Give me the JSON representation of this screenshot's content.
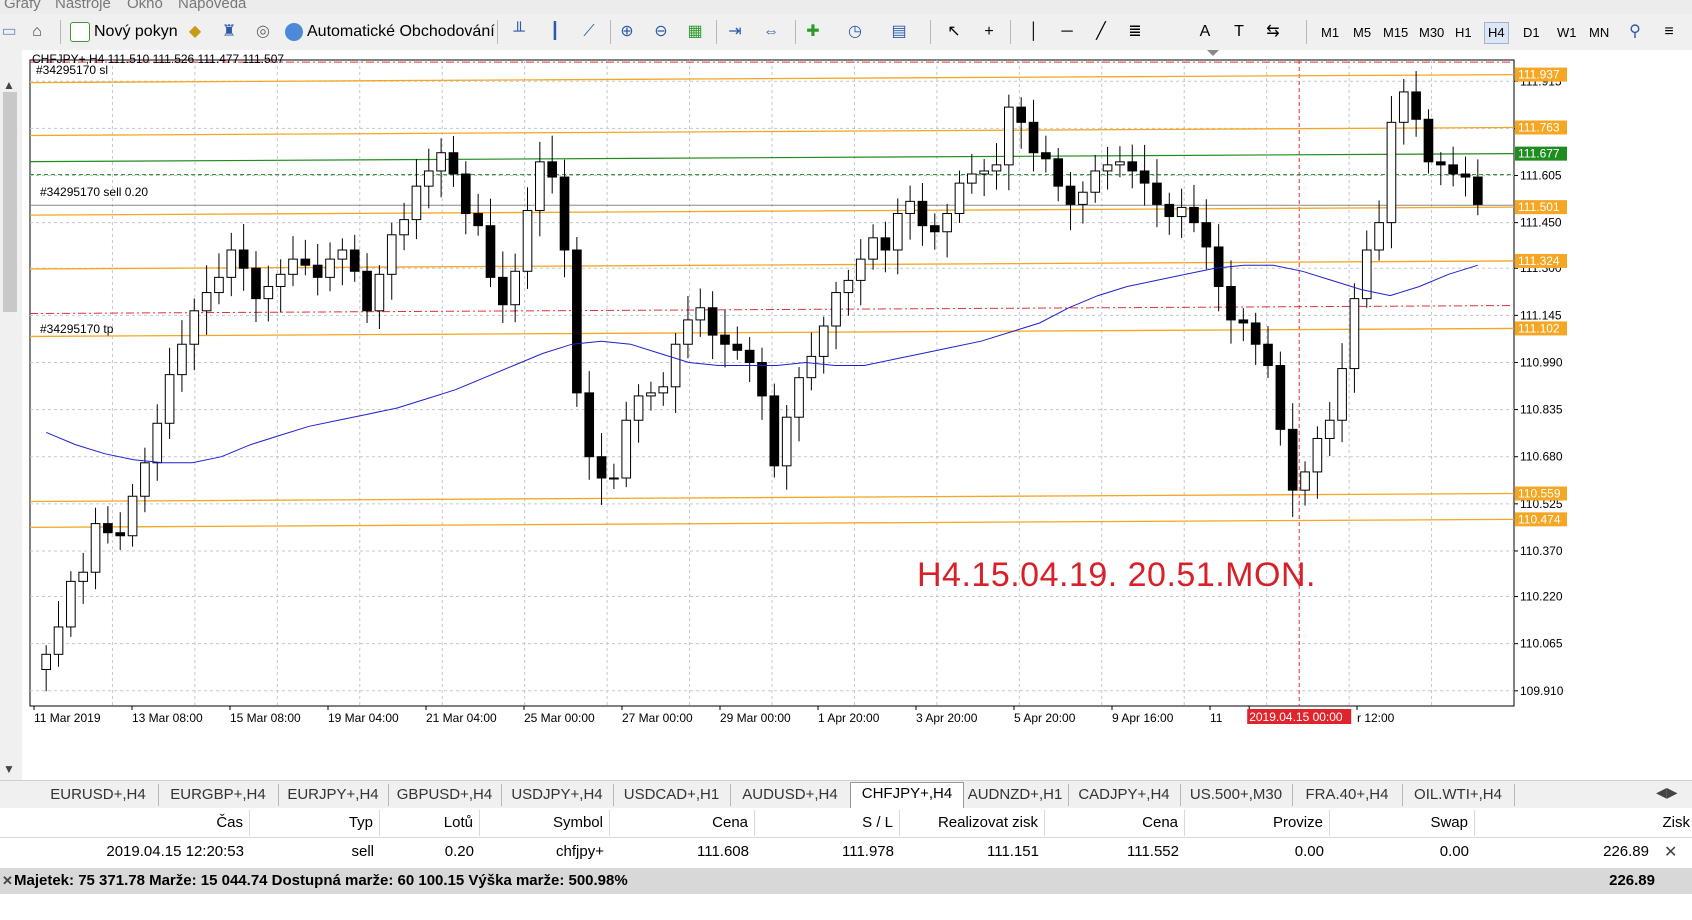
{
  "menu": [
    "Grafy",
    "Nástroje",
    "Okno",
    "Nápověda"
  ],
  "toolbar": {
    "new_order": "Nový pokyn",
    "auto_trading": "Automatické Obchodování",
    "timeframes": [
      "M1",
      "M5",
      "M15",
      "M30",
      "H1",
      "H4",
      "D1",
      "W1",
      "MN"
    ],
    "active_timeframe": "H4"
  },
  "chart": {
    "header": "CHFJPY+,H4  111.510 111.526 111.477 111.507",
    "order_sl_label": "#34295170 sl",
    "order_label": "#34295170 sell 0.20",
    "order_tp_label": "#34295170 tp",
    "annotation": "H4.15.04.19. 20.51.MON.",
    "time_label_current": "2019.04.15 00:00",
    "colors": {
      "bull": "#ffffff",
      "bear": "#000000",
      "grid": "#c0c7d4",
      "ma": "#2020d0",
      "support": "#f5a623",
      "entry": "#1e8c1e",
      "sl": "#e0303a",
      "annotation": "#d8202a"
    }
  },
  "chart_data": {
    "type": "candlestick",
    "symbol": "CHFJPY+",
    "timeframe": "H4",
    "ohlc_current": {
      "open": 111.51,
      "high": 111.526,
      "low": 111.477,
      "close": 111.507
    },
    "y_ticks": [
      111.915,
      111.76,
      111.605,
      111.45,
      111.3,
      111.145,
      110.99,
      110.835,
      110.68,
      110.525,
      110.37,
      110.22,
      110.065,
      109.91
    ],
    "ylim": [
      109.86,
      111.985
    ],
    "x_ticks": [
      "11 Mar 2019",
      "13 Mar 08:00",
      "15 Mar 08:00",
      "19 Mar 04:00",
      "21 Mar 04:00",
      "25 Mar 00:00",
      "27 Mar 00:00",
      "29 Mar 00:00",
      "1 Apr 20:00",
      "3 Apr 20:00",
      "5 Apr 20:00",
      "9 Apr 16:00",
      "11",
      "2019.04.15 00:00",
      "r 12:00"
    ],
    "price_labels": [
      {
        "value": 111.937,
        "color": "#f5a623"
      },
      {
        "value": 111.763,
        "color": "#f5a623"
      },
      {
        "value": 111.677,
        "color": "#1e8c1e"
      },
      {
        "value": 111.501,
        "color": "#f5a623"
      },
      {
        "value": 111.324,
        "color": "#f5a623"
      },
      {
        "value": 111.102,
        "color": "#f5a623"
      },
      {
        "value": 110.559,
        "color": "#f5a623"
      },
      {
        "value": 110.474,
        "color": "#f5a623"
      }
    ],
    "close_series": [
      110.03,
      110.12,
      110.27,
      110.3,
      110.46,
      110.43,
      110.42,
      110.55,
      110.66,
      110.79,
      110.95,
      111.05,
      111.16,
      111.22,
      111.27,
      111.36,
      111.3,
      111.2,
      111.24,
      111.28,
      111.33,
      111.31,
      111.27,
      111.33,
      111.36,
      111.29,
      111.16,
      111.28,
      111.41,
      111.46,
      111.57,
      111.62,
      111.68,
      111.61,
      111.48,
      111.44,
      111.27,
      111.18,
      111.29,
      111.49,
      111.65,
      111.6,
      111.36,
      110.89,
      110.68,
      110.61,
      110.61,
      110.8,
      110.88,
      110.89,
      110.91,
      111.05,
      111.13,
      111.17,
      111.08,
      111.05,
      111.03,
      110.99,
      110.88,
      110.65,
      110.81,
      110.94,
      111.01,
      111.11,
      111.22,
      111.26,
      111.33,
      111.4,
      111.36,
      111.48,
      111.52,
      111.44,
      111.42,
      111.48,
      111.58,
      111.61,
      111.62,
      111.64,
      111.83,
      111.78,
      111.68,
      111.66,
      111.57,
      111.51,
      111.55,
      111.62,
      111.64,
      111.65,
      111.62,
      111.58,
      111.51,
      111.47,
      111.5,
      111.45,
      111.37,
      111.24,
      111.13,
      111.12,
      111.05,
      110.98,
      110.77,
      110.57,
      110.63,
      110.74,
      110.8,
      110.97,
      111.2,
      111.36,
      111.45,
      111.78,
      111.88,
      111.79,
      111.65,
      111.64,
      111.61,
      111.6,
      111.51
    ],
    "ma_series": [
      110.76,
      110.72,
      110.69,
      110.67,
      110.66,
      110.66,
      110.68,
      110.72,
      110.75,
      110.78,
      110.8,
      110.82,
      110.84,
      110.87,
      110.9,
      110.94,
      110.98,
      111.02,
      111.05,
      111.06,
      111.05,
      111.02,
      110.99,
      110.98,
      110.98,
      110.98,
      110.99,
      110.98,
      110.98,
      111.0,
      111.02,
      111.04,
      111.06,
      111.09,
      111.12,
      111.17,
      111.21,
      111.24,
      111.26,
      111.28,
      111.3,
      111.31,
      111.31,
      111.29,
      111.26,
      111.23,
      111.21,
      111.24,
      111.28,
      111.31
    ],
    "indicators": [
      "Moving Average"
    ]
  },
  "tabs": [
    "EURUSD+,H4",
    "EURGBP+,H4",
    "EURJPY+,H4",
    "GBPUSD+,H4",
    "USDJPY+,H4",
    "USDCAD+,H1",
    "AUDUSD+,H4",
    "CHFJPY+,H4",
    "AUDNZD+,H1",
    "CADJPY+,H4",
    "US.500+,M30",
    "FRA.40+,H4",
    "OIL.WTI+,H4"
  ],
  "active_tab": "CHFJPY+,H4",
  "terminal": {
    "columns": [
      "Čas",
      "Typ",
      "Lotů",
      "Symbol",
      "Cena",
      "S / L",
      "Realizovat zisk",
      "Cena",
      "Provize",
      "Swap",
      "Zisk"
    ],
    "row": [
      "2019.04.15 12:20:53",
      "sell",
      "0.20",
      "chfjpy+",
      "111.608",
      "111.978",
      "111.151",
      "111.552",
      "0.00",
      "0.00",
      "226.89"
    ],
    "balance_text": "Majetek: 75 371.78  Marže: 15 044.74  Dostupná marže: 60 100.15  Výška marže: 500.98%",
    "balance_total": "226.89"
  }
}
